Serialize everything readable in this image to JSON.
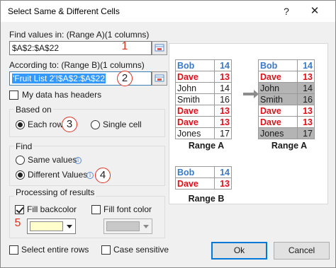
{
  "window": {
    "title": "Select Same & Different Cells",
    "help_label": "?",
    "close_label": "✕"
  },
  "range_a": {
    "label": "Find values in: (Range A)(1 columns)",
    "value": "$A$2:$A$22",
    "step": "1"
  },
  "range_b": {
    "label": "According to: (Range B)(1 columns)",
    "value": "'Fruit List 2'!$A$2:$A$22",
    "step": "2"
  },
  "headers_option": {
    "label": "My data has headers",
    "checked": false
  },
  "based_on": {
    "title": "Based on",
    "each_row": "Each row",
    "single_cell": "Single cell",
    "step": "3"
  },
  "find": {
    "title": "Find",
    "same_values": "Same values",
    "different_values": "Different Values",
    "step": "4"
  },
  "processing": {
    "title": "Processing of results",
    "fill_backcolor": "Fill backcolor",
    "fill_font_color": "Fill font color",
    "backcolor_value": "#ffffcc",
    "step": "5"
  },
  "footer": {
    "select_entire_rows": "Select entire rows",
    "case_sensitive": "Case sensitive",
    "ok": "Ok",
    "cancel": "Cancel"
  },
  "preview": {
    "range_a_before": {
      "caption": "Range A",
      "rows": [
        {
          "name": "Bob",
          "num": "14",
          "color": "blue"
        },
        {
          "name": "Dave",
          "num": "13",
          "color": "red"
        },
        {
          "name": "John",
          "num": "14",
          "color": "plain"
        },
        {
          "name": "Smith",
          "num": "16",
          "color": "plain"
        },
        {
          "name": "Dave",
          "num": "13",
          "color": "red"
        },
        {
          "name": "Dave",
          "num": "13",
          "color": "red"
        },
        {
          "name": "Jones",
          "num": "17",
          "color": "plain"
        }
      ]
    },
    "range_a_after": {
      "caption": "Range A",
      "rows": [
        {
          "name": "Bob",
          "num": "14",
          "color": "blue",
          "highlight": false
        },
        {
          "name": "Dave",
          "num": "13",
          "color": "red",
          "highlight": false
        },
        {
          "name": "John",
          "num": "14",
          "color": "plain",
          "highlight": true
        },
        {
          "name": "Smith",
          "num": "16",
          "color": "plain",
          "highlight": true
        },
        {
          "name": "Dave",
          "num": "13",
          "color": "red",
          "highlight": false
        },
        {
          "name": "Dave",
          "num": "13",
          "color": "red",
          "highlight": false
        },
        {
          "name": "Jones",
          "num": "17",
          "color": "plain",
          "highlight": true
        }
      ]
    },
    "range_b": {
      "caption": "Range B",
      "rows": [
        {
          "name": "Bob",
          "num": "14",
          "color": "blue"
        },
        {
          "name": "Dave",
          "num": "13",
          "color": "red"
        }
      ]
    }
  }
}
